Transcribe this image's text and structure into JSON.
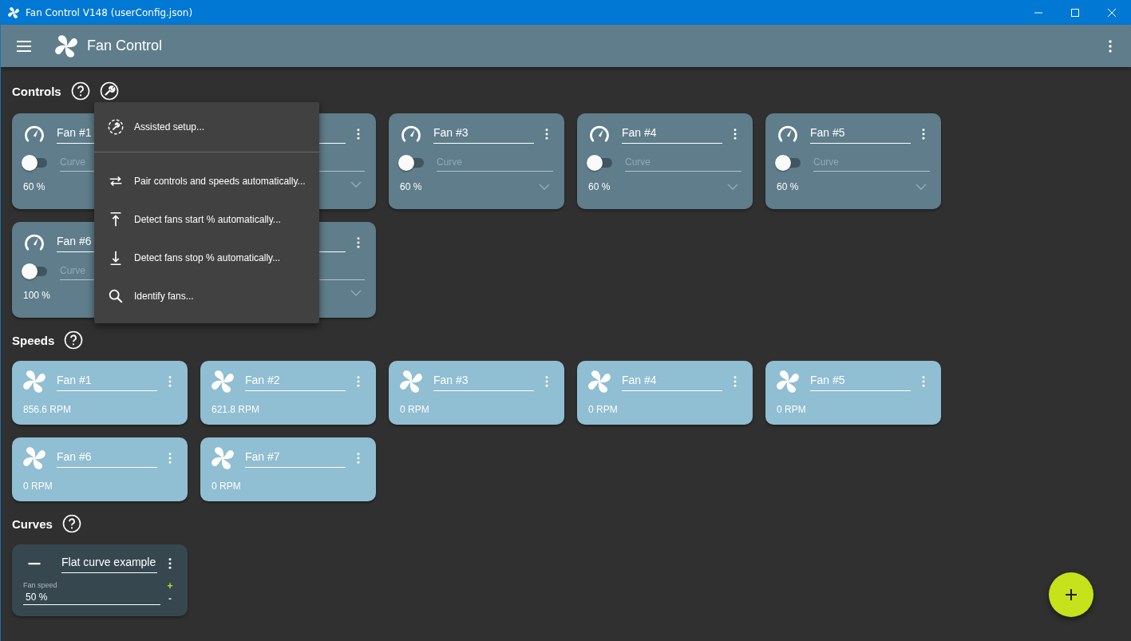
{
  "window": {
    "title": "Fan Control V148 (userConfig.json)"
  },
  "app_bar": {
    "title": "Fan Control"
  },
  "controls": {
    "heading": "Controls",
    "cards": [
      {
        "kind": "open",
        "name": "Fan #1",
        "placeholder": "Curve",
        "reading": "60 %",
        "on": false
      },
      {
        "kind": "covered"
      },
      {
        "kind": "open",
        "name": "Fan #3",
        "placeholder": "Curve",
        "reading": "60 %",
        "on": false
      },
      {
        "kind": "open",
        "name": "Fan #4",
        "placeholder": "Curve",
        "reading": "60 %",
        "on": false
      },
      {
        "kind": "open",
        "name": "Fan #5",
        "placeholder": "Curve",
        "reading": "60 %",
        "on": false
      },
      {
        "kind": "open",
        "name": "Fan #6",
        "placeholder": "Curve",
        "reading": "100 %",
        "on": false
      },
      {
        "kind": "covered"
      }
    ]
  },
  "menu": {
    "items": [
      {
        "label": "Assisted setup...",
        "kind": "assist",
        "divider": true
      },
      {
        "label": "Pair controls and speeds automatically...",
        "kind": "pair",
        "divider": false
      },
      {
        "label": "Detect fans start % automatically...",
        "kind": "start",
        "divider": false
      },
      {
        "label": "Detect fans stop % automatically...",
        "kind": "stop",
        "divider": false
      },
      {
        "label": "Identify fans...",
        "kind": "identify",
        "divider": false
      }
    ]
  },
  "speeds": {
    "heading": "Speeds",
    "cards": [
      {
        "name": "Fan #1",
        "reading": "856.6 RPM"
      },
      {
        "name": "Fan #2",
        "reading": "621.8 RPM"
      },
      {
        "name": "Fan #3",
        "reading": "0 RPM"
      },
      {
        "name": "Fan #4",
        "reading": "0 RPM"
      },
      {
        "name": "Fan #5",
        "reading": "0 RPM"
      },
      {
        "name": "Fan #6",
        "reading": "0 RPM"
      },
      {
        "name": "Fan #7",
        "reading": "0 RPM"
      }
    ]
  },
  "curves": {
    "heading": "Curves",
    "cards": [
      {
        "kind": "flat",
        "name": "Flat curve example",
        "label": "Fan speed",
        "value": "50 %",
        "increment": "+",
        "decrement": "-"
      }
    ]
  }
}
